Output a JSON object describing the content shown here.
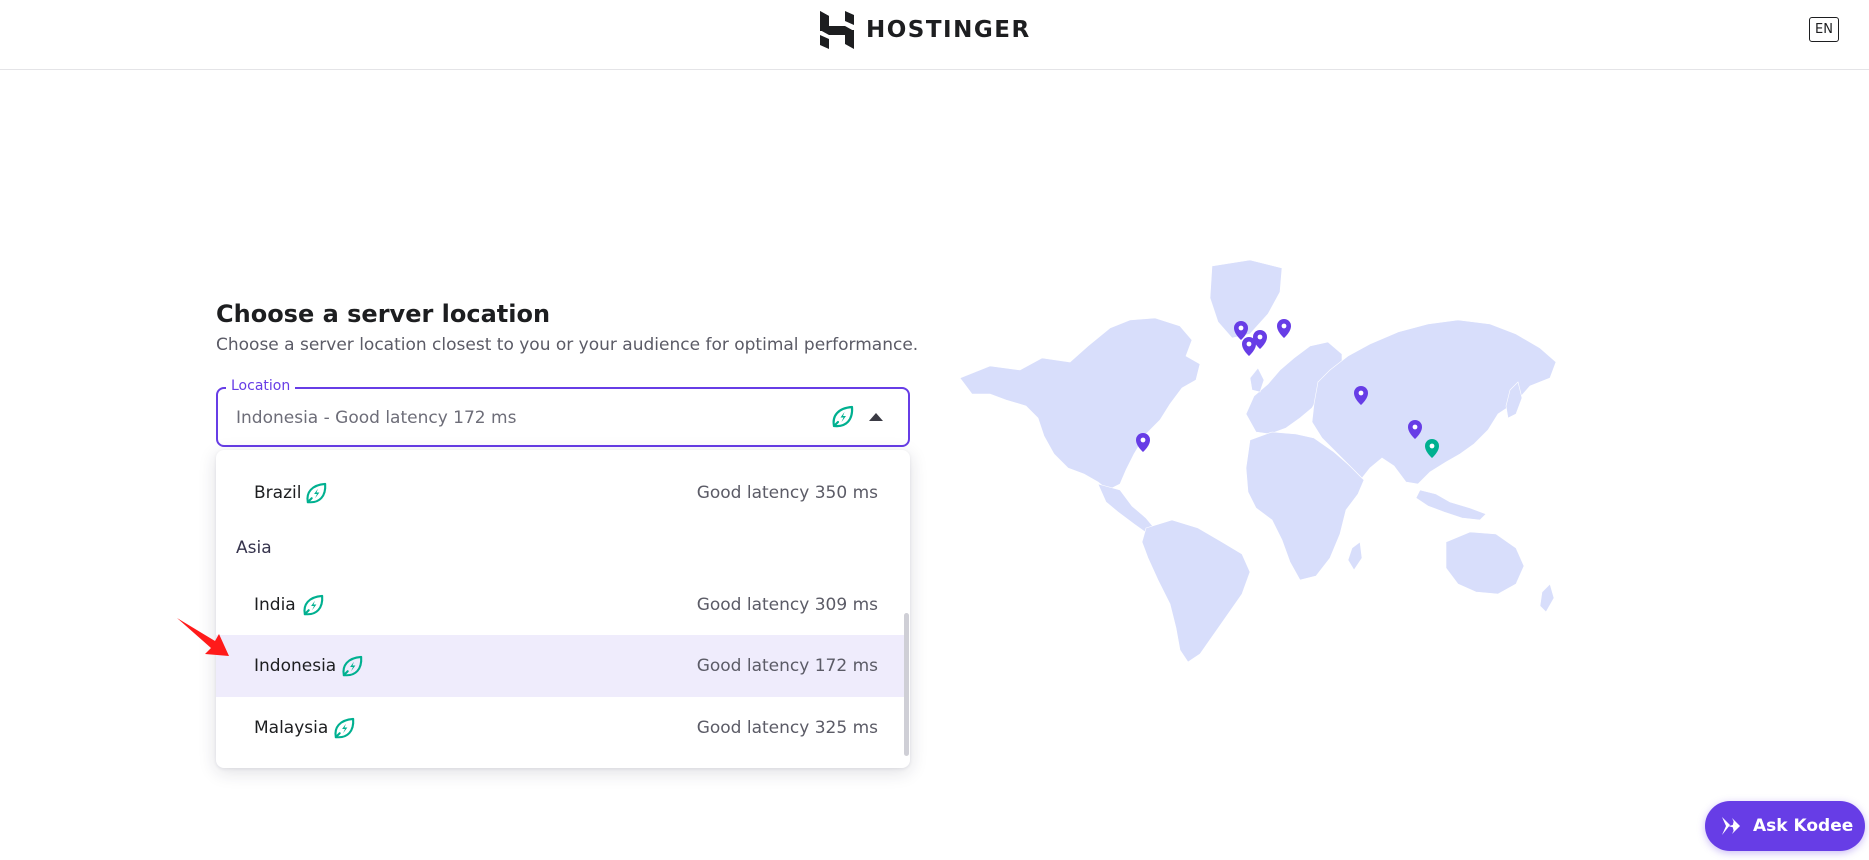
{
  "header": {
    "brand": "HOSTINGER",
    "language": "EN"
  },
  "page": {
    "title": "Choose a server location",
    "subtitle": "Choose a server location closest to you or your audience for optimal performance."
  },
  "select": {
    "label": "Location",
    "value": "Indonesia - Good latency 172 ms"
  },
  "dropdown": {
    "options": [
      {
        "name": "Brazil",
        "latency": "Good latency 350 ms"
      },
      {
        "group": "Asia"
      },
      {
        "name": "India",
        "latency": "Good latency 309 ms"
      },
      {
        "name": "Indonesia",
        "latency": "Good latency 172 ms",
        "selected": true
      },
      {
        "name": "Malaysia",
        "latency": "Good latency 325 ms"
      }
    ]
  },
  "assistant": {
    "label": "Ask Kodee"
  },
  "icons": {
    "leaf": "leaf-bolt-icon",
    "caret": "caret-up-icon",
    "marker": "map-pin-icon"
  },
  "colors": {
    "accent": "#673de6",
    "green": "#00b090",
    "selected_bg": "#efecfc",
    "map_land": "#d8defb",
    "pointer": "#ff1a1a"
  }
}
